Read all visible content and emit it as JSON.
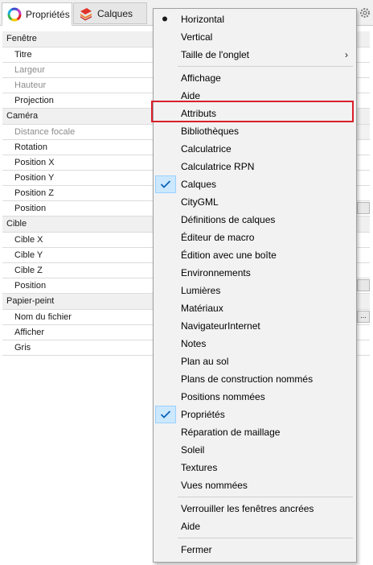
{
  "tabs": [
    {
      "label": "Propriétés",
      "active": true,
      "icon": "color-wheel-icon"
    },
    {
      "label": "Calques",
      "active": false,
      "icon": "layers-icon"
    }
  ],
  "panel": {
    "sections": [
      {
        "title": "Fenêtre",
        "rows": [
          {
            "label": "Titre",
            "enabled": true
          },
          {
            "label": "Largeur",
            "enabled": false
          },
          {
            "label": "Hauteur",
            "enabled": false
          },
          {
            "label": "Projection",
            "enabled": true
          }
        ]
      },
      {
        "title": "Caméra",
        "rows": [
          {
            "label": "Distance focale",
            "enabled": false
          },
          {
            "label": "Rotation",
            "enabled": true
          },
          {
            "label": "Position X",
            "enabled": true
          },
          {
            "label": "Position Y",
            "enabled": true
          },
          {
            "label": "Position Z",
            "enabled": true
          },
          {
            "label": "Position",
            "enabled": true
          }
        ]
      },
      {
        "title": "Cible",
        "rows": [
          {
            "label": "Cible X",
            "enabled": true
          },
          {
            "label": "Cible Y",
            "enabled": true
          },
          {
            "label": "Cible Z",
            "enabled": true
          },
          {
            "label": "Position",
            "enabled": true
          }
        ]
      },
      {
        "title": "Papier-peint",
        "rows": [
          {
            "label": "Nom du fichier",
            "enabled": true
          },
          {
            "label": "Afficher",
            "enabled": true
          },
          {
            "label": "Gris",
            "enabled": true
          }
        ]
      }
    ],
    "file_button_label": "..."
  },
  "context_menu": {
    "groups": [
      [
        {
          "label": "Horizontal",
          "mark": "bullet"
        },
        {
          "label": "Vertical"
        },
        {
          "label": "Taille de l'onglet",
          "submenu": "›"
        }
      ],
      [
        {
          "label": "Affichage"
        },
        {
          "label": "Aide"
        },
        {
          "label": "Attributs",
          "highlighted": true
        },
        {
          "label": "Bibliothèques"
        },
        {
          "label": "Calculatrice"
        },
        {
          "label": "Calculatrice RPN"
        },
        {
          "label": "Calques",
          "mark": "check"
        },
        {
          "label": "CityGML"
        },
        {
          "label": "Définitions de calques"
        },
        {
          "label": "Éditeur de macro"
        },
        {
          "label": "Édition avec une boîte"
        },
        {
          "label": "Environnements"
        },
        {
          "label": "Lumières"
        },
        {
          "label": "Matériaux"
        },
        {
          "label": "NavigateurInternet"
        },
        {
          "label": "Notes"
        },
        {
          "label": "Plan au sol"
        },
        {
          "label": "Plans de construction nommés"
        },
        {
          "label": "Positions nommées"
        },
        {
          "label": "Propriétés",
          "mark": "check"
        },
        {
          "label": "Réparation de maillage"
        },
        {
          "label": "Soleil"
        },
        {
          "label": "Textures"
        },
        {
          "label": "Vues nommées"
        }
      ],
      [
        {
          "label": "Verrouiller les fenêtres ancrées"
        },
        {
          "label": "Aide"
        }
      ],
      [
        {
          "label": "Fermer"
        }
      ]
    ]
  },
  "colors": {
    "highlight_border": "#d9202a",
    "check_background": "#cce8ff",
    "check_mark": "#0b63b5",
    "menu_background": "#f2f2f2"
  }
}
